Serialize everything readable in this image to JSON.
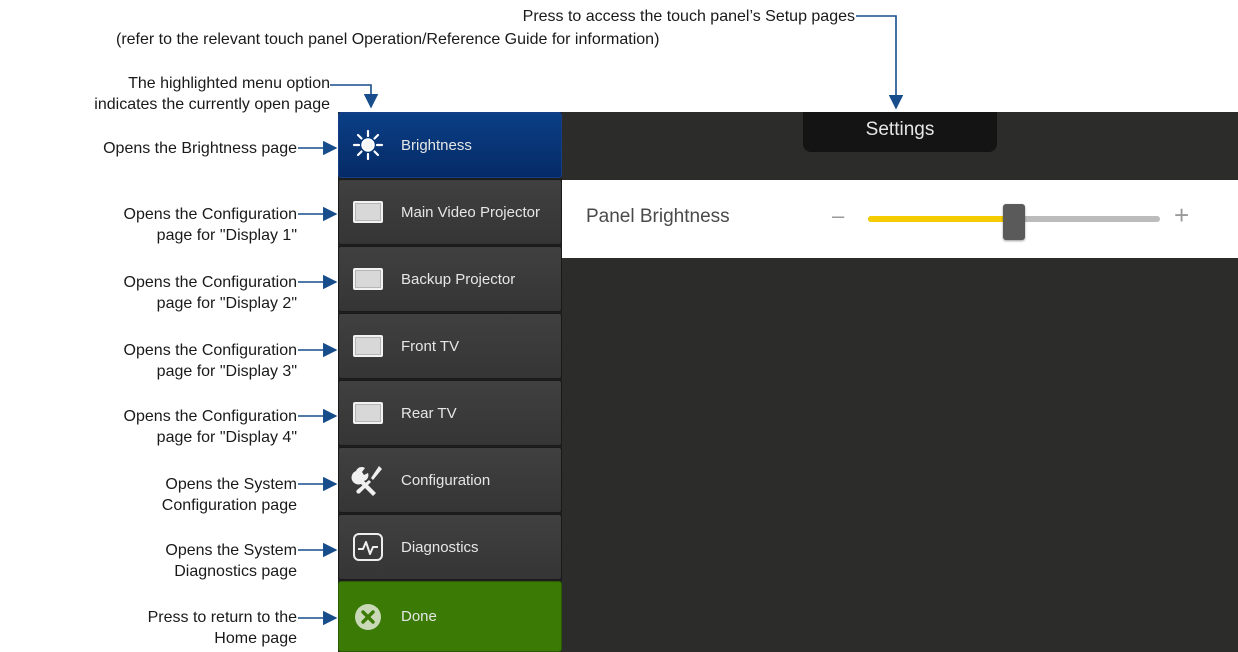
{
  "callouts": {
    "setup_line1": "Press to access the touch panel’s Setup pages",
    "setup_line2": "(refer to the relevant touch panel Operation/Reference Guide for information)",
    "highlight_line1": "The highlighted menu option",
    "highlight_line2": "indicates the currently open page",
    "brightness": "Opens the Brightness page",
    "display1_line1": "Opens the Configuration",
    "display1_line2": "page for \"Display 1\"",
    "display2_line1": "Opens the Configuration",
    "display2_line2": "page for \"Display 2\"",
    "display3_line1": "Opens the Configuration",
    "display3_line2": "page for \"Display 3\"",
    "display4_line1": "Opens the Configuration",
    "display4_line2": "page for \"Display 4\"",
    "config_line1": "Opens the System",
    "config_line2": "Configuration page",
    "diag_line1": "Opens the System",
    "diag_line2": "Diagnostics page",
    "done_line1": "Press to return to the",
    "done_line2": "Home page"
  },
  "sidebar": {
    "items": [
      {
        "label": "Brightness",
        "icon": "sun-icon"
      },
      {
        "label": "Main Video Projector",
        "icon": "display-icon"
      },
      {
        "label": "Backup Projector",
        "icon": "display-icon"
      },
      {
        "label": "Front TV",
        "icon": "display-icon"
      },
      {
        "label": "Rear TV",
        "icon": "display-icon"
      },
      {
        "label": "Configuration",
        "icon": "tools-icon"
      },
      {
        "label": "Diagnostics",
        "icon": "pulse-icon"
      },
      {
        "label": "Done",
        "icon": "close-circle-icon"
      }
    ],
    "active_index": 0
  },
  "settings": {
    "tab_label": "Settings",
    "brightness_label": "Panel Brightness",
    "minus": "–",
    "plus": "+",
    "brightness_level": 0.5
  },
  "colors": {
    "active_item": "#0b3f86",
    "done_item": "#3a7a05",
    "slider_fill": "#f4cc00",
    "leader": "#164d8a"
  }
}
